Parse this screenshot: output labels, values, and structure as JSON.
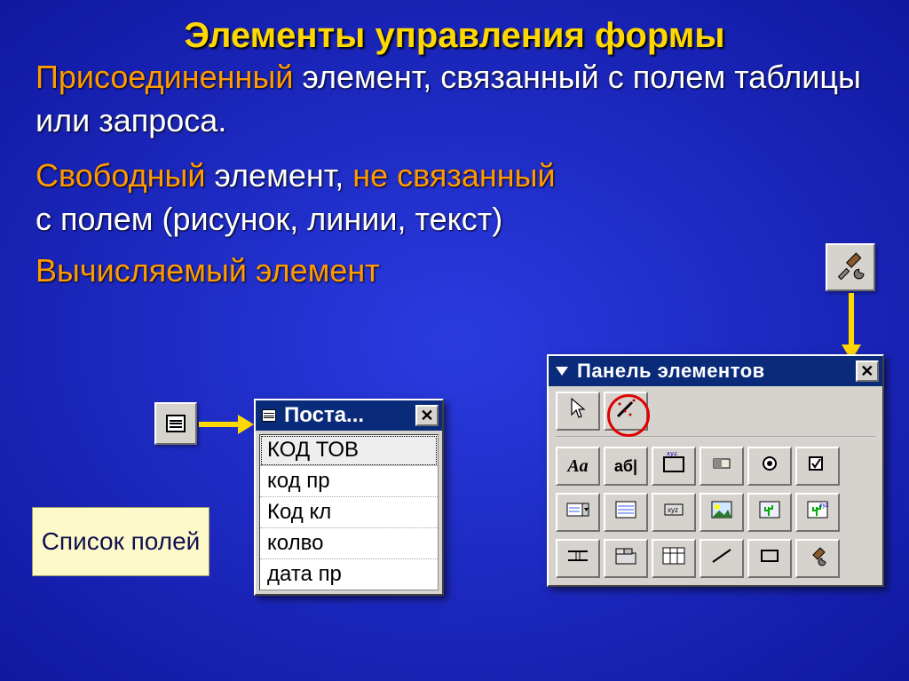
{
  "title": "Элементы управления формы",
  "p1": {
    "a": "Присоединенный",
    "b": " элемент, связанный с полем таблицы или запроса."
  },
  "p2": {
    "a": "Свободный",
    "b": " элемент, ",
    "c": "не связанный"
  },
  "p3": "с полем  (рисунок, линии, текст)",
  "p4": "Вычисляемый элемент",
  "fields_label": "Список полей",
  "field_window": {
    "title": "Поста...",
    "rows": [
      "КОД ТОВ",
      "код пр",
      "Код кл",
      "колво",
      "дата пр"
    ]
  },
  "toolbox": {
    "title": "Панель элементов",
    "row1": [
      {
        "name": "label-tool",
        "glyph": "Aa",
        "style": "italic bold 20px 'Times New Roman'"
      },
      {
        "name": "textbox-tool",
        "glyph": "аб|",
        "style": "bold 18px Arial"
      },
      {
        "name": "group-tool",
        "svg": "group"
      },
      {
        "name": "toggle-tool",
        "svg": "toggle"
      },
      {
        "name": "option-tool",
        "svg": "radio"
      },
      {
        "name": "checkbox-tool",
        "svg": "check"
      }
    ],
    "row2": [
      {
        "name": "combo-tool",
        "svg": "combo"
      },
      {
        "name": "listbox-tool",
        "svg": "list"
      },
      {
        "name": "button-tool",
        "svg": "btn"
      },
      {
        "name": "image-tool",
        "svg": "img"
      },
      {
        "name": "unbound-obj-tool",
        "svg": "cactus"
      },
      {
        "name": "bound-obj-tool",
        "svg": "cactus2"
      }
    ],
    "row3": [
      {
        "name": "pagebreak-tool",
        "svg": "pgbrk"
      },
      {
        "name": "tab-tool",
        "svg": "tabs"
      },
      {
        "name": "subform-tool",
        "svg": "subf"
      },
      {
        "name": "line-tool",
        "svg": "line"
      },
      {
        "name": "rect-tool",
        "svg": "rect"
      },
      {
        "name": "more-tool",
        "svg": "hammer"
      }
    ]
  }
}
